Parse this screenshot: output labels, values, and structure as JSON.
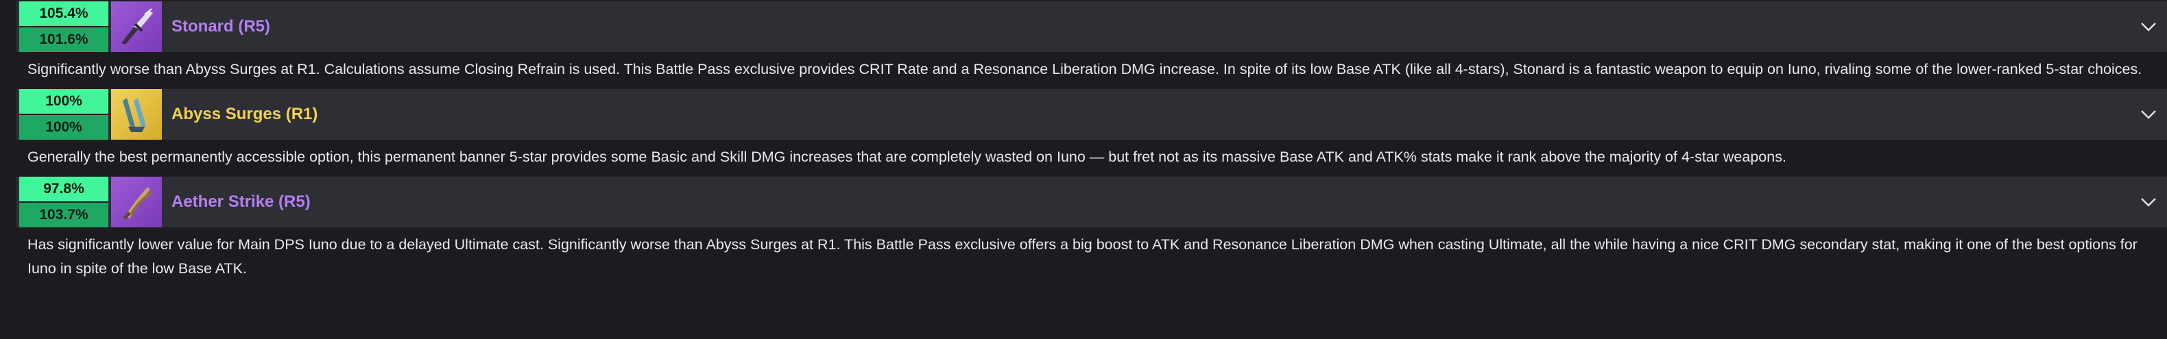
{
  "weapons": [
    {
      "pct_top": "105.4%",
      "pct_bottom": "101.6%",
      "name": "Stonard (R5)",
      "rarity": "4-star",
      "icon": "stonard-weapon-icon",
      "description": "Significantly worse than Abyss Surges at R1. Calculations assume Closing Refrain is used. This Battle Pass exclusive provides CRIT Rate and a Resonance Liberation DMG increase. In spite of its low Base ATK (like all 4-stars), Stonard is a fantastic weapon to equip on Iuno, rivaling some of the lower-ranked 5-star choices."
    },
    {
      "pct_top": "100%",
      "pct_bottom": "100%",
      "name": "Abyss Surges (R1)",
      "rarity": "5-star",
      "icon": "abyss-surges-weapon-icon",
      "description": "Generally the best permanently accessible option, this permanent banner 5-star provides some Basic and Skill DMG increases that are completely wasted on Iuno — but fret not as its massive Base ATK and ATK% stats make it rank above the majority of 4-star weapons."
    },
    {
      "pct_top": "97.8%",
      "pct_bottom": "103.7%",
      "name": "Aether Strike (R5)",
      "rarity": "4-star",
      "icon": "aether-strike-weapon-icon",
      "description": "Has significantly lower value for Main DPS Iuno due to a delayed Ultimate cast. Significantly worse than Abyss Surges at R1. This Battle Pass exclusive offers a big boost to ATK and Resonance Liberation DMG when casting Ultimate, all the while having a nice CRIT DMG secondary stat, making it one of the best options for Iuno in spite of the low Base ATK."
    }
  ],
  "colors": {
    "pct_top_bg": "#43f59a",
    "pct_bottom_bg": "#1fa864",
    "four_star_name": "#b67ef0",
    "five_star_name": "#f2d150",
    "header_bg": "#2e2f35",
    "page_bg": "#1c1c20"
  }
}
